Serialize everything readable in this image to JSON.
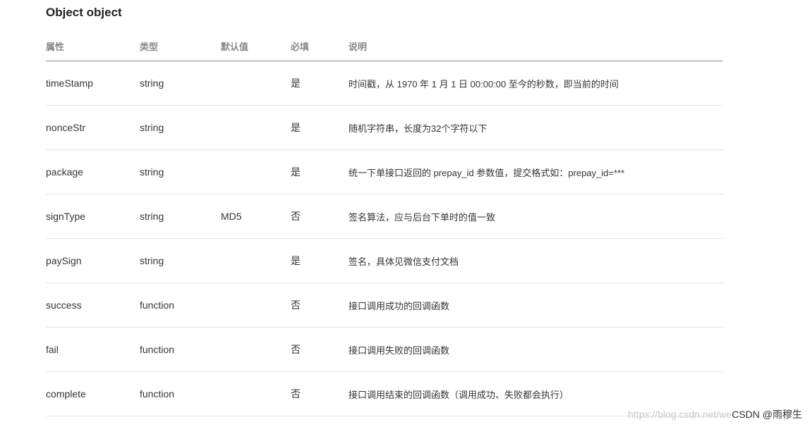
{
  "section": {
    "title": "Object object"
  },
  "table": {
    "headers": [
      "属性",
      "类型",
      "默认值",
      "必填",
      "说明"
    ],
    "rows": [
      {
        "name": "timeStamp",
        "type": "string",
        "default": "",
        "required": "是",
        "desc": "时间戳，从 1970 年 1 月 1 日 00:00:00 至今的秒数，即当前的时间"
      },
      {
        "name": "nonceStr",
        "type": "string",
        "default": "",
        "required": "是",
        "desc": "随机字符串，长度为32个字符以下"
      },
      {
        "name": "package",
        "type": "string",
        "default": "",
        "required": "是",
        "desc": "统一下单接口返回的 prepay_id 参数值，提交格式如：prepay_id=***"
      },
      {
        "name": "signType",
        "type": "string",
        "default": "MD5",
        "required": "否",
        "desc": "签名算法，应与后台下单时的值一致"
      },
      {
        "name": "paySign",
        "type": "string",
        "default": "",
        "required": "是",
        "desc": "签名，具体见微信支付文档"
      },
      {
        "name": "success",
        "type": "function",
        "default": "",
        "required": "否",
        "desc": "接口调用成功的回调函数"
      },
      {
        "name": "fail",
        "type": "function",
        "default": "",
        "required": "否",
        "desc": "接口调用失败的回调函数"
      },
      {
        "name": "complete",
        "type": "function",
        "default": "",
        "required": "否",
        "desc": "接口调用结束的回调函数（调用成功、失败都会执行）"
      }
    ]
  },
  "watermark": {
    "url": "https://blog.csdn.net/we",
    "brand": "CSDN @雨穆生"
  }
}
